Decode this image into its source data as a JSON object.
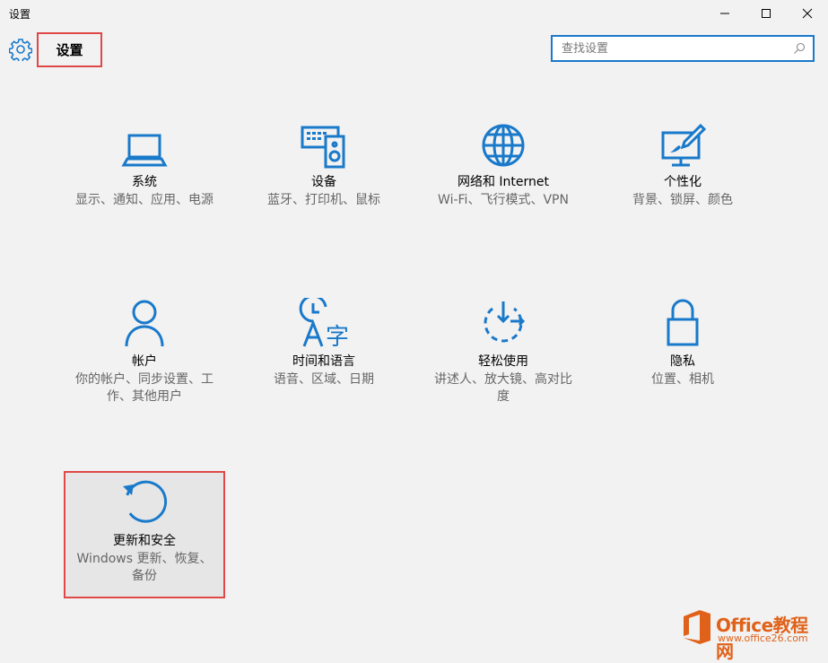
{
  "window": {
    "title": "设置",
    "controls": [
      "minimize-icon",
      "maximize-icon",
      "close-icon"
    ]
  },
  "header": {
    "icon": "gear-icon",
    "title": "设置"
  },
  "search": {
    "placeholder": "查找设置",
    "value": "",
    "icon": "search-icon"
  },
  "colors": {
    "accent": "#1979ca",
    "highlight_border": "#e04848",
    "background": "#f2f2f2",
    "description_text": "#666666"
  },
  "tiles": [
    {
      "name": "系统",
      "desc": "显示、通知、应用、电源",
      "icon": "laptop-icon"
    },
    {
      "name": "设备",
      "desc": "蓝牙、打印机、鼠标",
      "icon": "devices-icon"
    },
    {
      "name": "网络和 Internet",
      "desc": "Wi-Fi、飞行模式、VPN",
      "icon": "globe-icon"
    },
    {
      "name": "个性化",
      "desc": "背景、锁屏、颜色",
      "icon": "personalization-icon"
    },
    {
      "name": "帐户",
      "desc": "你的帐户、同步设置、工作、其他用户",
      "icon": "person-icon"
    },
    {
      "name": "时间和语言",
      "desc": "语音、区域、日期",
      "icon": "time-language-icon"
    },
    {
      "name": "轻松使用",
      "desc": "讲述人、放大镜、高对比度",
      "icon": "ease-of-access-icon"
    },
    {
      "name": "隐私",
      "desc": "位置、相机",
      "icon": "lock-icon"
    },
    {
      "name": "更新和安全",
      "desc": "Windows 更新、恢复、备份",
      "icon": "update-icon"
    }
  ],
  "watermark": {
    "brand": "Office教程网",
    "url": "www.office26.com",
    "icon": "office-logo-icon"
  }
}
